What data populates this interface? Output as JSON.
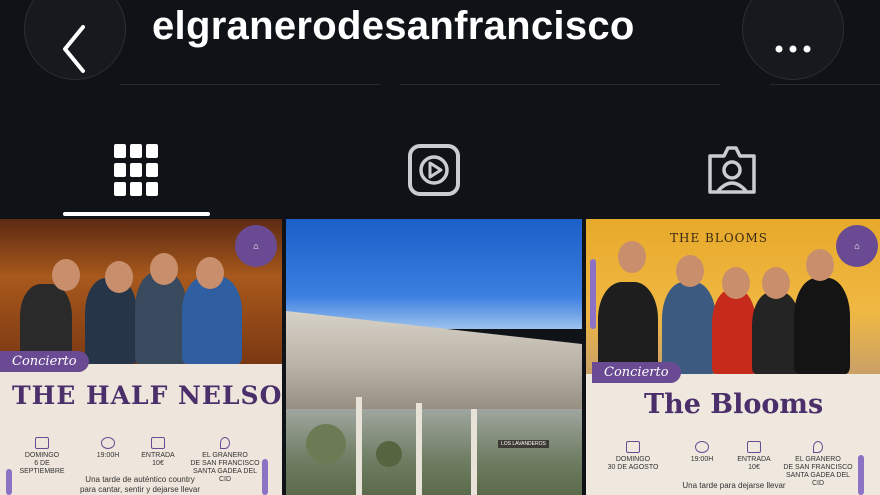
{
  "header": {
    "username": "elgranerodesanfrancisco",
    "back_icon": "chevron-left-icon",
    "more_icon": "more-horizontal-icon"
  },
  "tabs": [
    {
      "name": "grid-icon",
      "active": true
    },
    {
      "name": "reels-icon",
      "active": false
    },
    {
      "name": "tagged-icon",
      "active": false
    }
  ],
  "posts": [
    {
      "tag": "Concierto",
      "band": "THE HALF NELSONS",
      "day": "DOMINGO",
      "date": "6 DE SEPTIEMBRE",
      "time": "19:00H",
      "ticket_label": "ENTRADA",
      "ticket_price": "10€",
      "venue_line1": "EL GRANERO",
      "venue_line2": "DE SAN FRANCISCO",
      "venue_line3": "SANTA GADEA DEL CID",
      "desc_line1": "Una tarde de auténtico country",
      "desc_line2": "para cantar, sentir y dejarse llevar"
    },
    {
      "sign": "LOS LAVANDEROS"
    },
    {
      "title_banner": "THE BLOOMS",
      "tag": "Concierto",
      "band": "The Blooms",
      "day": "DOMINGO",
      "date": "30 DE AGOSTO",
      "time": "19:00H",
      "ticket_label": "ENTRADA",
      "ticket_price": "10€",
      "venue_line1": "EL GRANERO",
      "venue_line2": "DE SAN FRANCISCO",
      "venue_line3": "SANTA GADEA DEL CID",
      "desc_line1": "Una tarde para dejarse llevar"
    }
  ],
  "colors": {
    "background": "#0f1216",
    "accent_purple": "#6a4b93"
  }
}
